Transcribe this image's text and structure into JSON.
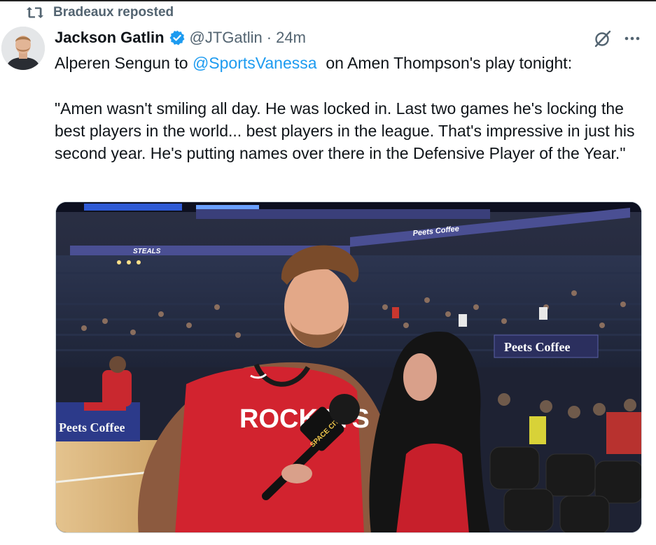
{
  "repost": {
    "icon": "repost-icon",
    "text": "Bradeaux reposted"
  },
  "author": {
    "display_name": "Jackson Gatlin",
    "verified_icon": "verified-badge-icon",
    "handle": "@JTGatlin",
    "separator": "·",
    "time": "24m"
  },
  "actions": {
    "grok_icon": "grok-icon",
    "more_icon": "more-icon"
  },
  "tweet": {
    "line1_prefix": "Alperen Sengun to ",
    "mention": "@SportsVanessa",
    "line1_suffix": "  on Amen Thompson's play tonight:",
    "quote": "\"Amen wasn't smiling all day. He was locked in. Last two games he's locking the best players in the world... best players in the league. That's impressive in just his second year. He's putting names over there in the Defensive Player of the Year.\""
  },
  "media": {
    "jersey_text": "ROCKETS",
    "sign_text": "Peets Coffee",
    "mic_flag_text": "SPACE CITY",
    "courtside_text": "Peets Coffee",
    "ribbon_text": "STEALS",
    "colors": {
      "jersey_red": "#d2232f",
      "arena_dark": "#1c2030",
      "seat_black": "#1a1a1a",
      "court_wood": "#d9b37a"
    }
  },
  "theme": {
    "accent": "#1d9bf0",
    "muted": "#536471",
    "text": "#0f1419"
  }
}
